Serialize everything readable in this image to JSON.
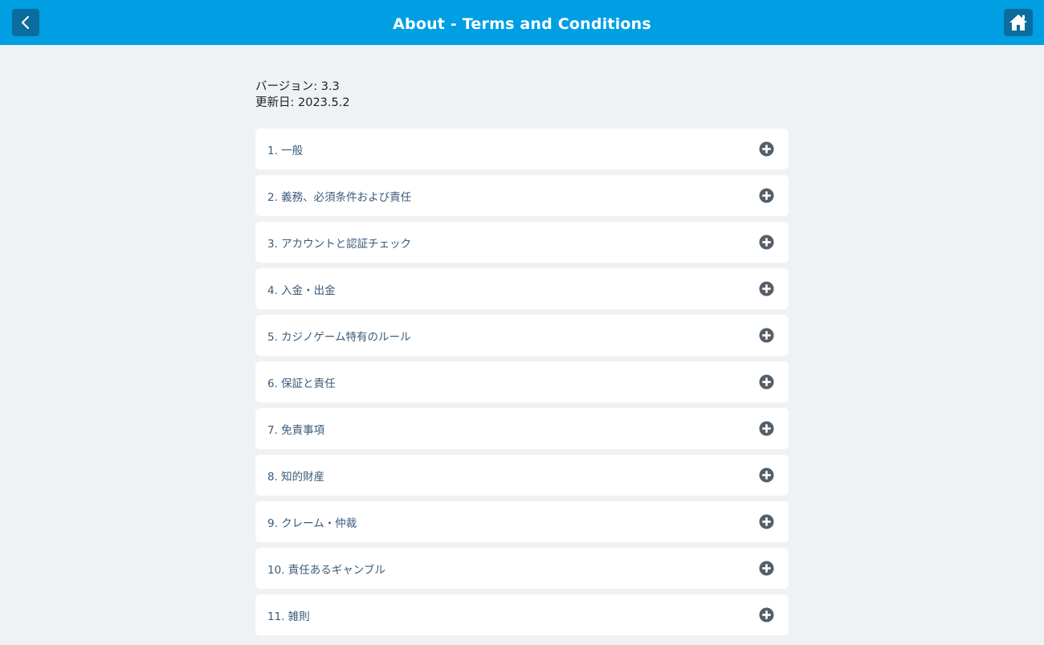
{
  "header": {
    "title": "About - Terms and Conditions",
    "back_icon": "chevron-left-icon",
    "home_icon": "home-icon"
  },
  "meta": {
    "version": "バージョン: 3.3",
    "updated": "更新日: 2023.5.2"
  },
  "sections": [
    {
      "label": "1. 一般"
    },
    {
      "label": "2. 義務、必須条件および責任"
    },
    {
      "label": "3. アカウントと認証チェック"
    },
    {
      "label": "4. 入金・出金"
    },
    {
      "label": "5. カジノゲーム特有のルール"
    },
    {
      "label": "6. 保証と責任"
    },
    {
      "label": "7. 免責事項"
    },
    {
      "label": "8. 知的財産"
    },
    {
      "label": "9. クレーム・仲裁"
    },
    {
      "label": "10. 責任あるギャンブル"
    },
    {
      "label": "11. 雑則"
    }
  ],
  "colors": {
    "header_bg": "#009fe3",
    "nav_button_bg": "#0b6c9e",
    "page_bg": "#eef2f5",
    "section_text": "#3a5a7a",
    "expand_icon": "#555f69"
  }
}
